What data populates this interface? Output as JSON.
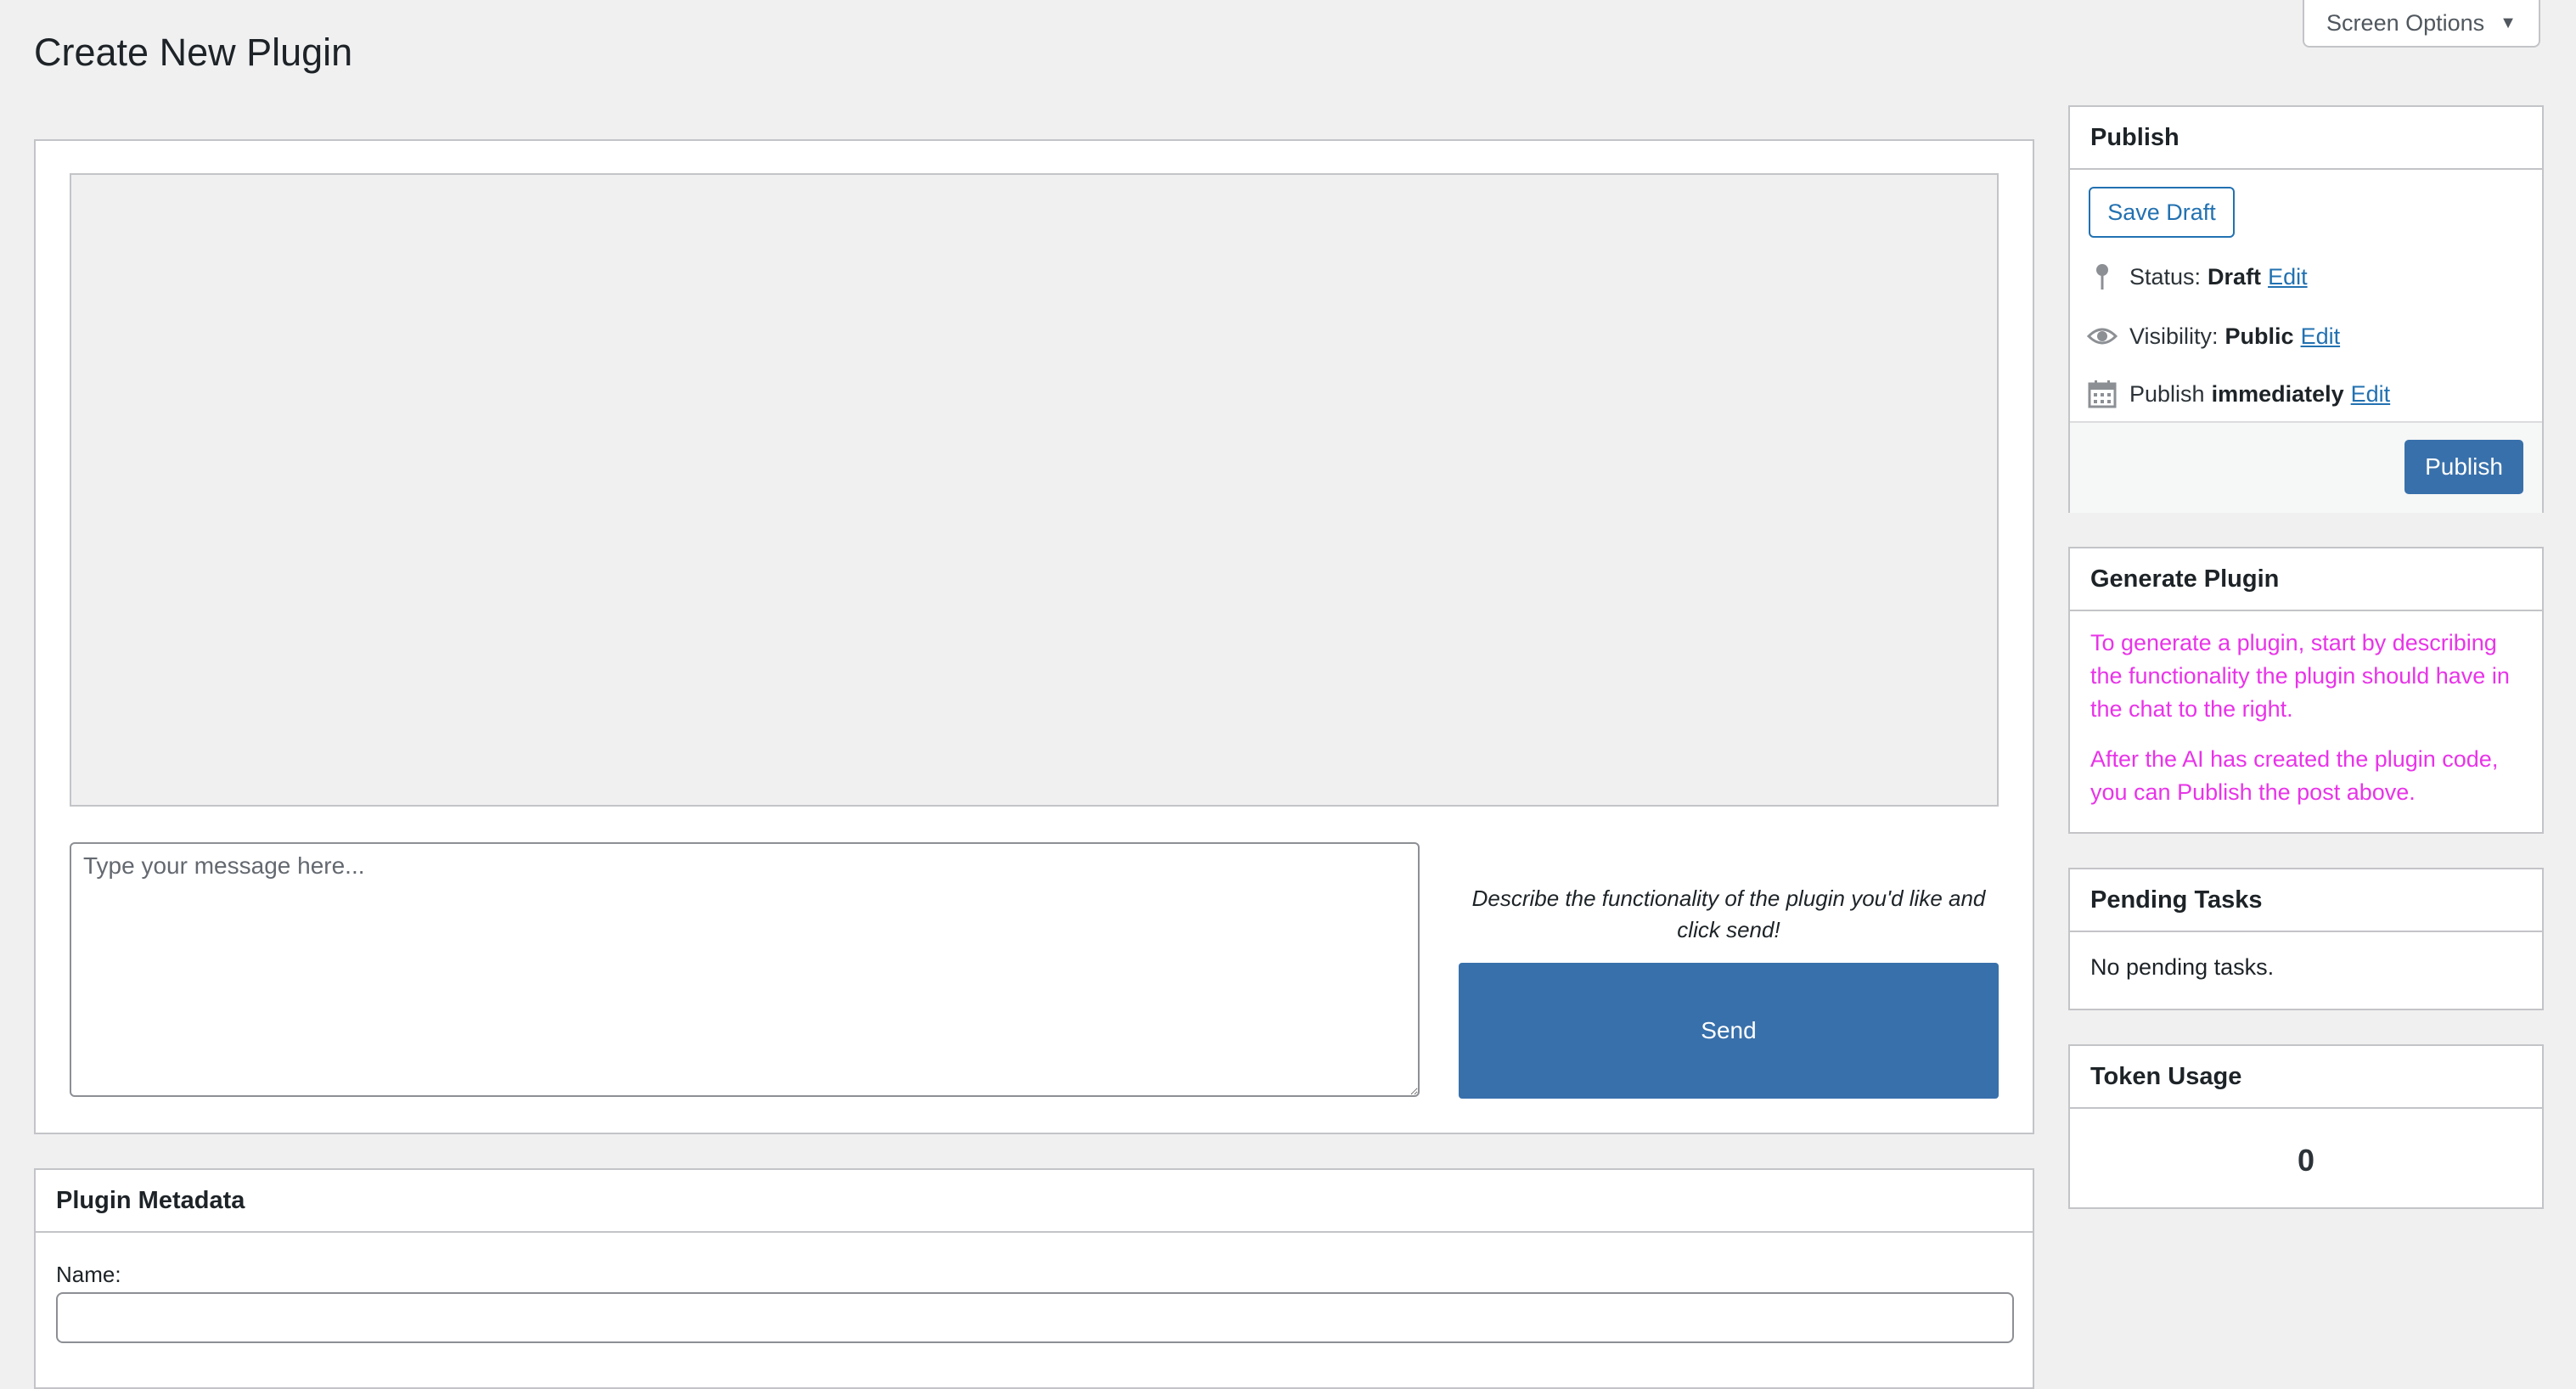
{
  "header": {
    "screen_options_label": "Screen Options",
    "page_title": "Create New Plugin"
  },
  "chat": {
    "input_placeholder": "Type your message here...",
    "hint": "Describe the functionality of the plugin you'd like and click send!",
    "send_label": "Send"
  },
  "metadata": {
    "title": "Plugin Metadata",
    "name_label": "Name:",
    "name_value": ""
  },
  "publish": {
    "title": "Publish",
    "save_draft_label": "Save Draft",
    "status_label": "Status:",
    "status_value": "Draft",
    "visibility_label": "Visibility:",
    "visibility_value": "Public",
    "schedule_label": "Publish",
    "schedule_value": "immediately",
    "edit_label": "Edit",
    "publish_label": "Publish",
    "icons": [
      "pin-icon",
      "eye-icon",
      "calendar-icon"
    ]
  },
  "generate": {
    "title": "Generate Plugin",
    "paragraph1": "To generate a plugin, start by describing the functionality the plugin should have in the chat to the right.",
    "paragraph2": "After the AI has created the plugin code, you can Publish the post above.",
    "text_color": "#e834e8"
  },
  "pending": {
    "title": "Pending Tasks",
    "message": "No pending tasks."
  },
  "tokens": {
    "title": "Token Usage",
    "count": "0"
  },
  "colors": {
    "primary_button": "#3870ab",
    "link": "#2271b1",
    "background": "#f0f0f1"
  }
}
